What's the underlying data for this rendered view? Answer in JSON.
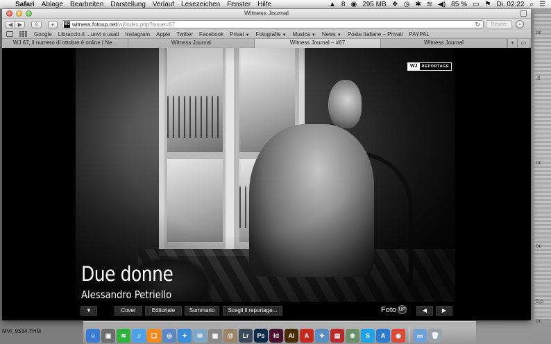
{
  "menubar": {
    "app_name": "Safari",
    "menus": [
      "Ablage",
      "Bearbeiten",
      "Darstellung",
      "Verlauf",
      "Lesezeichen",
      "Fenster",
      "Hilfe"
    ],
    "status": {
      "badge": "8",
      "memory": "295 MB",
      "battery": "85 %",
      "clock": "Di. 02:22"
    }
  },
  "window": {
    "title": "Witness Journal"
  },
  "toolbar": {
    "back": "◀",
    "forward": "▶",
    "share": "⇪",
    "add": "+",
    "url_host": "witness.fotoup.net",
    "url_path": "/wj/index.php?issue=67",
    "reader": "Reader"
  },
  "bookmarks": [
    {
      "label": "Google",
      "menu": false
    },
    {
      "label": "Libraccio.it ...uovi e usati",
      "menu": false
    },
    {
      "label": "Instagram",
      "menu": false
    },
    {
      "label": "Apple",
      "menu": false
    },
    {
      "label": "Twitter",
      "menu": false
    },
    {
      "label": "Facebook",
      "menu": false
    },
    {
      "label": "Privat",
      "menu": true
    },
    {
      "label": "Fotografie",
      "menu": true
    },
    {
      "label": "Musica",
      "menu": true
    },
    {
      "label": "News",
      "menu": true
    },
    {
      "label": "Poste Italiane – Privati",
      "menu": false
    },
    {
      "label": "PAYPAL",
      "menu": false
    }
  ],
  "tabs": [
    {
      "label": "WJ 67, il numero di ottobre è online | Ne..."
    },
    {
      "label": "Witness Journal"
    },
    {
      "label": "Witness Journal – #67"
    },
    {
      "label": "Witness Journal"
    }
  ],
  "page": {
    "logo_wj": "WJ",
    "logo_reportage": "REPORTAGE",
    "story_title": "Due donne",
    "story_author": "Alessandro Petriello",
    "nav": {
      "menu_toggle": "▼",
      "cover": "Cover",
      "editoriale": "Editoriale",
      "sommario": "Sommario",
      "scegli": "Scegli il reportage...",
      "prev": "◀",
      "next": "▶",
      "foto_logo": "Foto"
    }
  },
  "desktop": {
    "file_label": "MVI_9534.THM",
    "right_edge_labels": [
      "oc",
      ".it",
      "oc",
      "oc",
      "0,p",
      "oc"
    ]
  },
  "dock": {
    "apps": [
      {
        "icon": "finder-icon",
        "color": "#3b7bd4",
        "glyph": "☺"
      },
      {
        "icon": "screenshot-icon",
        "color": "#6d6d6d",
        "glyph": "▣"
      },
      {
        "icon": "spotify-icon",
        "color": "#2fb23e",
        "glyph": "≋"
      },
      {
        "icon": "itunes-icon",
        "color": "#4ea0e8",
        "glyph": "♫"
      },
      {
        "icon": "ibooks-icon",
        "color": "#f08a1d",
        "glyph": "❑"
      },
      {
        "icon": "iphoto-icon",
        "color": "#5d88c5",
        "glyph": "◎"
      },
      {
        "icon": "safari-icon",
        "color": "#3a8fd9",
        "glyph": "✦"
      },
      {
        "icon": "mail-icon",
        "color": "#7fa7c9",
        "glyph": "✉"
      },
      {
        "icon": "preview-icon",
        "color": "#8a8a8a",
        "glyph": "▦"
      },
      {
        "icon": "contacts-icon",
        "color": "#9c8466",
        "glyph": "@"
      },
      {
        "icon": "lightroom-icon",
        "color": "#3b4a5a",
        "glyph": "Lr"
      },
      {
        "icon": "photoshop-icon",
        "color": "#0e2a4a",
        "glyph": "Ps"
      },
      {
        "icon": "indesign-icon",
        "color": "#4a0f2e",
        "glyph": "Id"
      },
      {
        "icon": "illustrator-icon",
        "color": "#4a2a00",
        "glyph": "Ai"
      },
      {
        "icon": "acrobat-icon",
        "color": "#c52a1f",
        "glyph": "A"
      },
      {
        "icon": "mail-stamp-icon",
        "color": "#5a8dc0",
        "glyph": "✈"
      },
      {
        "icon": "photo-booth-icon",
        "color": "#b82a2a",
        "glyph": "▤"
      },
      {
        "icon": "photos-app-icon",
        "color": "#6b8e6b",
        "glyph": "❀"
      },
      {
        "icon": "skype-icon",
        "color": "#1ea3e6",
        "glyph": "S"
      },
      {
        "icon": "app-store-icon",
        "color": "#2e7ad1",
        "glyph": "A"
      },
      {
        "icon": "chrome-icon",
        "color": "#d94a38",
        "glyph": "◉"
      },
      {
        "icon": "folder-icon",
        "color": "#6fa0d6",
        "glyph": "▭"
      },
      {
        "icon": "trash-icon",
        "color": "#9aa3ab",
        "glyph": "🗑"
      }
    ]
  }
}
